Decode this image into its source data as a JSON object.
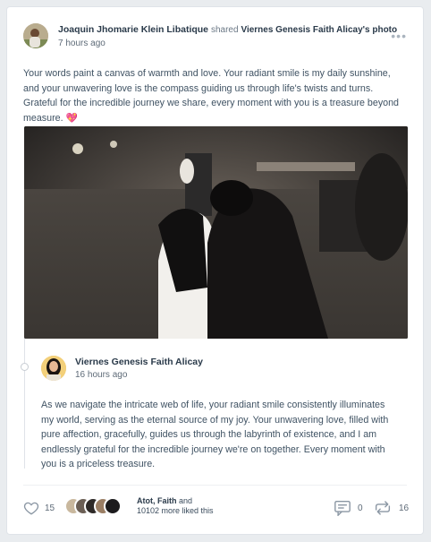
{
  "post": {
    "author": "Joaquin Jhomarie Klein Libatique",
    "action": "shared",
    "shared_from": "Viernes Genesis Faith Alicay's photo",
    "time": "7 hours ago",
    "more_icon": "more-horizontal-icon",
    "text": "Your words paint a canvas of warmth and love. Your radiant smile is my daily sunshine, and your unwavering love is the compass guiding us through life's twists and turns. Grateful for the incredible journey we share, every moment with you is a treasure beyond measure.",
    "emoji": "💖"
  },
  "shared_post": {
    "author": "Viernes Genesis Faith Alicay",
    "time": "16 hours ago",
    "text": "As we navigate the intricate web of life, your radiant smile consistently illuminates my world, serving as the eternal source of my joy. Your unwavering love, filled with pure affection, gracefully, guides us through the labyrinth of existence, and I am endlessly grateful for the incredible journey we're on together. Every moment with you is a priceless treasure."
  },
  "footer": {
    "like_icon": "heart-icon",
    "like_count": "15",
    "liked_by_names": "Atot, Faith",
    "liked_by_and": "and",
    "liked_by_rest": "10102 more liked this",
    "comment_icon": "comment-icon",
    "comment_count": "0",
    "share_icon": "share-icon",
    "share_count": "16"
  },
  "colors": {
    "accent_heart": "#e23b5b",
    "text": "#3f5263",
    "muted": "#5e6b78"
  }
}
